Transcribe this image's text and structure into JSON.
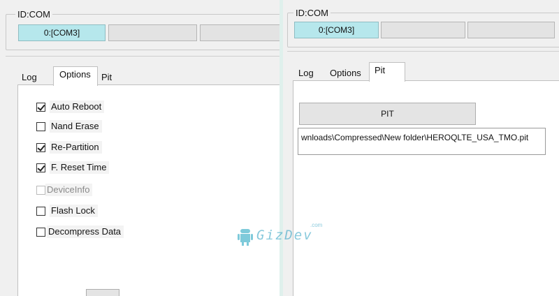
{
  "left": {
    "id_group": {
      "title": "ID:COM",
      "ports": [
        "0:[COM3]",
        "",
        ""
      ]
    },
    "tabs": [
      {
        "label": "Log",
        "selected": false
      },
      {
        "label": "Options",
        "selected": true
      },
      {
        "label": "Pit",
        "selected": false
      }
    ],
    "options": [
      {
        "label": "Auto Reboot",
        "checked": true,
        "enabled": true
      },
      {
        "label": "Nand Erase",
        "checked": false,
        "enabled": true
      },
      {
        "label": "Re-Partition",
        "checked": true,
        "enabled": true
      },
      {
        "label": "F. Reset Time",
        "checked": true,
        "enabled": true
      },
      {
        "label": "DeviceInfo",
        "checked": false,
        "enabled": false
      },
      {
        "label": "Flash Lock",
        "checked": false,
        "enabled": true
      },
      {
        "label": "Decompress Data",
        "checked": false,
        "enabled": true
      }
    ]
  },
  "right": {
    "id_group": {
      "title": "ID:COM",
      "ports": [
        "0:[COM3]",
        "",
        ""
      ]
    },
    "tabs": [
      {
        "label": "Log",
        "selected": false
      },
      {
        "label": "Options",
        "selected": false
      },
      {
        "label": "Pit",
        "selected": true
      }
    ],
    "pit_button_label": "PIT",
    "pit_path": "wnloads\\Compressed\\New folder\\HEROQLTE_USA_TMO.pit"
  },
  "watermark": {
    "text": "GizDev",
    "suffix": ".com"
  },
  "colors": {
    "active_port": "#b6e7ec",
    "background": "#f0f0f0",
    "outer_bg": "#dff0ec"
  }
}
